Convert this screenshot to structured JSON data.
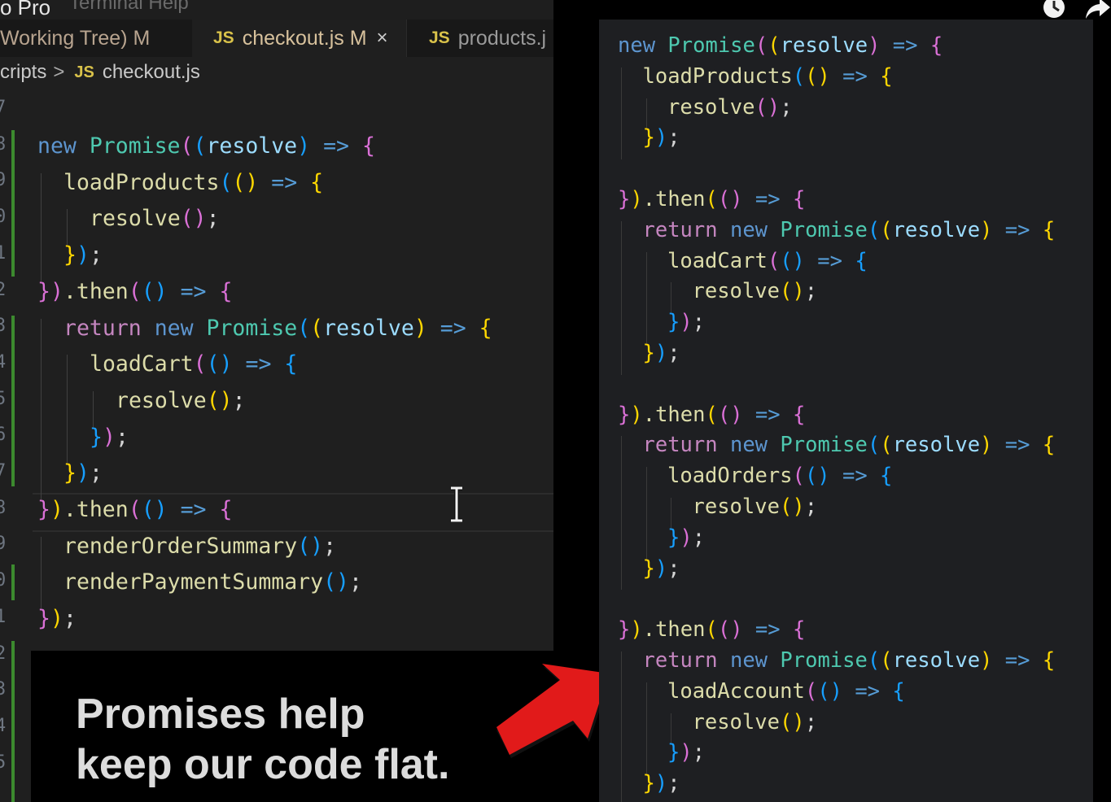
{
  "window": {
    "app_title": "o Pro",
    "menu_faded": "Terminal   Help"
  },
  "tabs": [
    {
      "label": "Working Tree) M",
      "icon": ""
    },
    {
      "label": "checkout.js M",
      "icon": "JS",
      "close": "×"
    },
    {
      "label": "products.j",
      "icon": "JS"
    }
  ],
  "breadcrumb": {
    "folder": "cripts",
    "separator": ">",
    "icon": "JS",
    "file": "checkout.js"
  },
  "gutter_numbers": [
    "7",
    "8",
    "9",
    "0",
    "1",
    "2",
    "3",
    "4",
    "5",
    "6",
    "7",
    "8",
    "9",
    "0",
    "1",
    "2",
    "3",
    "4",
    "5"
  ],
  "caption": {
    "line1": "Promises help",
    "line2": "keep our code flat."
  },
  "colors": {
    "overlay_arrow": "#e11a1a",
    "keyword": "#c586c0",
    "function": "#dcdcaa",
    "class": "#4ec9b0"
  },
  "icons": {
    "clock": "clock-icon",
    "share": "share-icon",
    "text_cursor": "text-cursor-icon",
    "arrow": "red-arrow-icon"
  },
  "left_code": [
    {
      "indent": 0,
      "tokens": [
        [
          "new ",
          "kw-blue"
        ],
        [
          "Promise",
          "cls"
        ],
        [
          "(",
          "b2"
        ],
        [
          "(",
          "b3"
        ],
        [
          "resolve",
          "param"
        ],
        [
          ")",
          "b3"
        ],
        [
          " => ",
          "arrow"
        ],
        [
          "{",
          "b2"
        ]
      ]
    },
    {
      "indent": 1,
      "tokens": [
        [
          "loadProducts",
          "fn"
        ],
        [
          "(",
          "b3"
        ],
        [
          "()",
          "b1"
        ],
        [
          " => ",
          "arrow"
        ],
        [
          "{",
          "b1"
        ]
      ]
    },
    {
      "indent": 2,
      "tokens": [
        [
          "resolve",
          "fn"
        ],
        [
          "()",
          "b2"
        ],
        [
          ";",
          "txt"
        ]
      ]
    },
    {
      "indent": 1,
      "tokens": [
        [
          "}",
          "b1"
        ],
        [
          ")",
          "b3"
        ],
        [
          ";",
          "txt"
        ]
      ]
    },
    {
      "indent": 0,
      "tokens": [
        [
          "}",
          "b2"
        ],
        [
          ")",
          "b2"
        ],
        [
          ".then",
          "fn"
        ],
        [
          "(",
          "b2"
        ],
        [
          "()",
          "b3"
        ],
        [
          " => ",
          "arrow"
        ],
        [
          "{",
          "b2"
        ]
      ]
    },
    {
      "indent": 1,
      "tokens": [
        [
          "return ",
          "kw-purple"
        ],
        [
          "new ",
          "kw-blue"
        ],
        [
          "Promise",
          "cls"
        ],
        [
          "(",
          "b3"
        ],
        [
          "(",
          "b1"
        ],
        [
          "resolve",
          "param"
        ],
        [
          ")",
          "b1"
        ],
        [
          " => ",
          "arrow"
        ],
        [
          "{",
          "b1"
        ]
      ]
    },
    {
      "indent": 2,
      "tokens": [
        [
          "loadCart",
          "fn"
        ],
        [
          "(",
          "b2"
        ],
        [
          "()",
          "b3"
        ],
        [
          " => ",
          "arrow"
        ],
        [
          "{",
          "b3"
        ]
      ]
    },
    {
      "indent": 3,
      "tokens": [
        [
          "resolve",
          "fn"
        ],
        [
          "()",
          "b1"
        ],
        [
          ";",
          "txt"
        ]
      ]
    },
    {
      "indent": 2,
      "tokens": [
        [
          "}",
          "b3"
        ],
        [
          ")",
          "b2"
        ],
        [
          ";",
          "txt"
        ]
      ]
    },
    {
      "indent": 1,
      "tokens": [
        [
          "}",
          "b1"
        ],
        [
          ")",
          "b3"
        ],
        [
          ";",
          "txt"
        ]
      ]
    },
    {
      "indent": 0,
      "tokens": [
        [
          "}",
          "b2"
        ],
        [
          ")",
          "b1"
        ],
        [
          ".then",
          "fn"
        ],
        [
          "(",
          "b2"
        ],
        [
          "()",
          "b3"
        ],
        [
          " => ",
          "arrow"
        ],
        [
          "{",
          "b2"
        ]
      ]
    },
    {
      "indent": 1,
      "tokens": [
        [
          "renderOrderSummary",
          "fn"
        ],
        [
          "()",
          "b3"
        ],
        [
          ";",
          "txt"
        ]
      ]
    },
    {
      "indent": 1,
      "tokens": [
        [
          "renderPaymentSummary",
          "fn"
        ],
        [
          "()",
          "b3"
        ],
        [
          ";",
          "txt"
        ]
      ]
    },
    {
      "indent": 0,
      "tokens": [
        [
          "}",
          "b2"
        ],
        [
          ")",
          "b1"
        ],
        [
          ";",
          "txt"
        ]
      ]
    }
  ],
  "right_code": [
    {
      "indent": 0,
      "tokens": [
        [
          "new ",
          "kw-blue"
        ],
        [
          "Promise",
          "cls"
        ],
        [
          "(",
          "b2"
        ],
        [
          "(",
          "b1"
        ],
        [
          "resolve",
          "param"
        ],
        [
          ")",
          "b2"
        ],
        [
          " => ",
          "arrow"
        ],
        [
          "{",
          "b2"
        ]
      ]
    },
    {
      "indent": 1,
      "tokens": [
        [
          "loadProducts",
          "fn"
        ],
        [
          "(",
          "b3"
        ],
        [
          "()",
          "b1"
        ],
        [
          " => ",
          "arrow"
        ],
        [
          "{",
          "b1"
        ]
      ]
    },
    {
      "indent": 2,
      "tokens": [
        [
          "resolve",
          "fn"
        ],
        [
          "()",
          "b2"
        ],
        [
          ";",
          "txt"
        ]
      ]
    },
    {
      "indent": 1,
      "tokens": [
        [
          "}",
          "b1"
        ],
        [
          ")",
          "b3"
        ],
        [
          ";",
          "txt"
        ]
      ]
    },
    {
      "indent": 0,
      "tokens": []
    },
    {
      "indent": 0,
      "tokens": [
        [
          "}",
          "b2"
        ],
        [
          ")",
          "b1"
        ],
        [
          ".then",
          "fn"
        ],
        [
          "(",
          "b1"
        ],
        [
          "()",
          "b2"
        ],
        [
          " => ",
          "arrow"
        ],
        [
          "{",
          "b2"
        ]
      ]
    },
    {
      "indent": 1,
      "tokens": [
        [
          "return ",
          "kw-purple"
        ],
        [
          "new ",
          "kw-blue"
        ],
        [
          "Promise",
          "cls"
        ],
        [
          "(",
          "b3"
        ],
        [
          "(",
          "b1"
        ],
        [
          "resolve",
          "param"
        ],
        [
          ")",
          "b1"
        ],
        [
          " => ",
          "arrow"
        ],
        [
          "{",
          "b1"
        ]
      ]
    },
    {
      "indent": 2,
      "tokens": [
        [
          "loadCart",
          "fn"
        ],
        [
          "(",
          "b2"
        ],
        [
          "()",
          "b3"
        ],
        [
          " => ",
          "arrow"
        ],
        [
          "{",
          "b3"
        ]
      ]
    },
    {
      "indent": 3,
      "tokens": [
        [
          "resolve",
          "fn"
        ],
        [
          "()",
          "b1"
        ],
        [
          ";",
          "txt"
        ]
      ]
    },
    {
      "indent": 2,
      "tokens": [
        [
          "}",
          "b3"
        ],
        [
          ")",
          "b2"
        ],
        [
          ";",
          "txt"
        ]
      ]
    },
    {
      "indent": 1,
      "tokens": [
        [
          "}",
          "b1"
        ],
        [
          ")",
          "b3"
        ],
        [
          ";",
          "txt"
        ]
      ]
    },
    {
      "indent": 0,
      "tokens": []
    },
    {
      "indent": 0,
      "tokens": [
        [
          "}",
          "b2"
        ],
        [
          ")",
          "b1"
        ],
        [
          ".then",
          "fn"
        ],
        [
          "(",
          "b1"
        ],
        [
          "()",
          "b2"
        ],
        [
          " => ",
          "arrow"
        ],
        [
          "{",
          "b2"
        ]
      ]
    },
    {
      "indent": 1,
      "tokens": [
        [
          "return ",
          "kw-purple"
        ],
        [
          "new ",
          "kw-blue"
        ],
        [
          "Promise",
          "cls"
        ],
        [
          "(",
          "b3"
        ],
        [
          "(",
          "b1"
        ],
        [
          "resolve",
          "param"
        ],
        [
          ")",
          "b1"
        ],
        [
          " => ",
          "arrow"
        ],
        [
          "{",
          "b1"
        ]
      ]
    },
    {
      "indent": 2,
      "tokens": [
        [
          "loadOrders",
          "fn"
        ],
        [
          "(",
          "b2"
        ],
        [
          "()",
          "b3"
        ],
        [
          " => ",
          "arrow"
        ],
        [
          "{",
          "b3"
        ]
      ]
    },
    {
      "indent": 3,
      "tokens": [
        [
          "resolve",
          "fn"
        ],
        [
          "()",
          "b1"
        ],
        [
          ";",
          "txt"
        ]
      ]
    },
    {
      "indent": 2,
      "tokens": [
        [
          "}",
          "b3"
        ],
        [
          ")",
          "b2"
        ],
        [
          ";",
          "txt"
        ]
      ]
    },
    {
      "indent": 1,
      "tokens": [
        [
          "}",
          "b1"
        ],
        [
          ")",
          "b3"
        ],
        [
          ";",
          "txt"
        ]
      ]
    },
    {
      "indent": 0,
      "tokens": []
    },
    {
      "indent": 0,
      "tokens": [
        [
          "}",
          "b2"
        ],
        [
          ")",
          "b1"
        ],
        [
          ".then",
          "fn"
        ],
        [
          "(",
          "b1"
        ],
        [
          "()",
          "b2"
        ],
        [
          " => ",
          "arrow"
        ],
        [
          "{",
          "b2"
        ]
      ]
    },
    {
      "indent": 1,
      "tokens": [
        [
          "return ",
          "kw-purple"
        ],
        [
          "new ",
          "kw-blue"
        ],
        [
          "Promise",
          "cls"
        ],
        [
          "(",
          "b3"
        ],
        [
          "(",
          "b1"
        ],
        [
          "resolve",
          "param"
        ],
        [
          ")",
          "b1"
        ],
        [
          " => ",
          "arrow"
        ],
        [
          "{",
          "b1"
        ]
      ]
    },
    {
      "indent": 2,
      "tokens": [
        [
          "loadAccount",
          "fn"
        ],
        [
          "(",
          "b2"
        ],
        [
          "()",
          "b3"
        ],
        [
          " => ",
          "arrow"
        ],
        [
          "{",
          "b3"
        ]
      ]
    },
    {
      "indent": 3,
      "tokens": [
        [
          "resolve",
          "fn"
        ],
        [
          "()",
          "b1"
        ],
        [
          ";",
          "txt"
        ]
      ]
    },
    {
      "indent": 2,
      "tokens": [
        [
          "}",
          "b3"
        ],
        [
          ")",
          "b2"
        ],
        [
          ";",
          "txt"
        ]
      ]
    },
    {
      "indent": 1,
      "tokens": [
        [
          "}",
          "b1"
        ],
        [
          ")",
          "b3"
        ],
        [
          ";",
          "txt"
        ]
      ]
    }
  ]
}
